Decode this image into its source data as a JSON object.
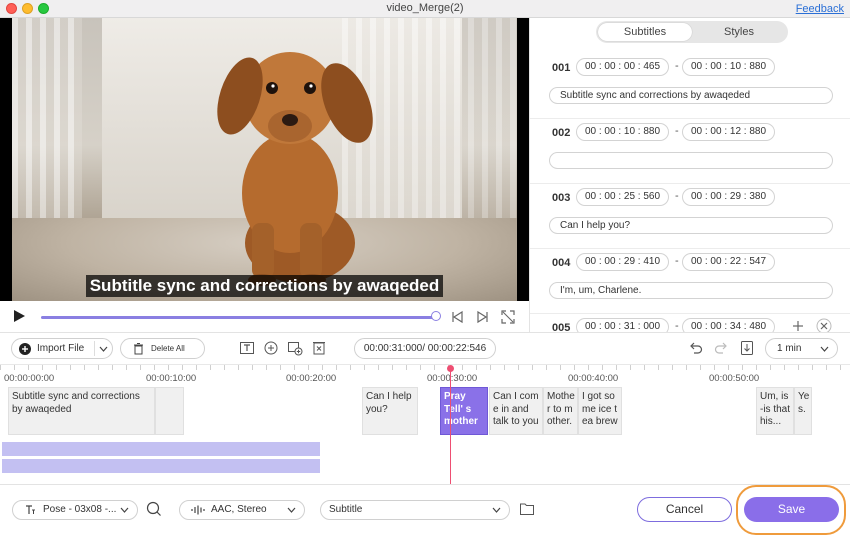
{
  "window": {
    "title": "video_Merge(2)",
    "feedback_label": "Feedback"
  },
  "video": {
    "subtitle_overlay": "Subtitle sync and corrections by awaqeded",
    "progress_fraction": 0.99
  },
  "panel": {
    "tabs": [
      "Subtitles",
      "Styles"
    ],
    "active_tab": "Subtitles",
    "entries": [
      {
        "num": "001",
        "start": "00 : 00 : 00 : 465",
        "end": "00 : 00 : 10 : 880",
        "text": "Subtitle sync and corrections by awaqeded"
      },
      {
        "num": "002",
        "start": "00 : 00 : 10 : 880",
        "end": "00 : 00 : 12 : 880",
        "text": ""
      },
      {
        "num": "003",
        "start": "00 : 00 : 25 : 560",
        "end": "00 : 00 : 29 : 380",
        "text": "Can I help you?"
      },
      {
        "num": "004",
        "start": "00 : 00 : 29 : 410",
        "end": "00 : 00 : 22 : 547",
        "text": "I'm, um, Charlene."
      },
      {
        "num": "005",
        "start": "00 : 00 : 31 : 000",
        "end": "00 : 00 : 34 : 480",
        "text": ""
      }
    ],
    "dash": "-"
  },
  "toolbar": {
    "import_label": "Import File",
    "delete_label": "Delete All",
    "timecode": "00:00:31:000/ 00:00:22:546",
    "zoom": "1 min"
  },
  "timeline": {
    "ruler_labels": [
      "00:00:00:00",
      "00:00:10:00",
      "00:00:20:00",
      "00:00:30:00",
      "00:00:40:00",
      "00:00:50:00"
    ],
    "clips": [
      {
        "text": "Subtitle sync and corrections by awaqeded"
      },
      {
        "text": ""
      },
      {
        "text": "Can I help you?"
      },
      {
        "text": "Pray Tell' s mother"
      },
      {
        "text": "Can I com e in and talk to you"
      },
      {
        "text": "Mothe r to m other."
      },
      {
        "text": "I got so me ice t ea brew"
      },
      {
        "text": "Um, is -is that his..."
      },
      {
        "text": "Ye s."
      }
    ]
  },
  "bottom": {
    "format": "Pose - 03x08 -...",
    "audio": "AAC, Stereo",
    "subtitle": "Subtitle",
    "cancel_label": "Cancel",
    "save_label": "Save"
  },
  "colors": {
    "accent": "#8a6ee9",
    "highlight_ring": "#ef9b3c",
    "playhead": "#ee4e72"
  }
}
